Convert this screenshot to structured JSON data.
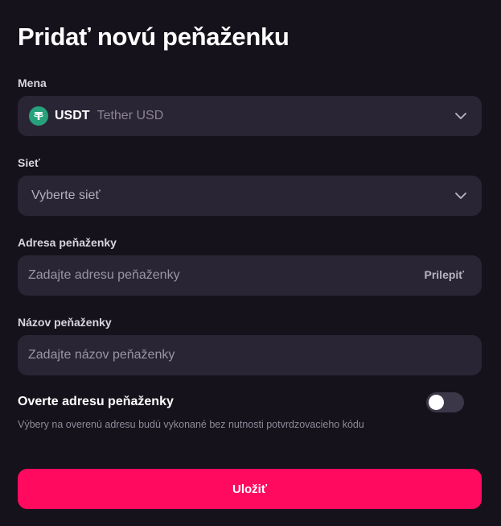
{
  "modal": {
    "title": "Pridať novú peňaženku"
  },
  "currency": {
    "label": "Mena",
    "code": "USDT",
    "name": "Tether USD",
    "icon": "tether-icon",
    "icon_color": "#26a17b"
  },
  "network": {
    "label": "Sieť",
    "placeholder": "Vyberte sieť"
  },
  "address": {
    "label": "Adresa peňaženky",
    "placeholder": "Zadajte adresu peňaženky",
    "value": "",
    "paste_label": "Prilepiť"
  },
  "wallet_name": {
    "label": "Názov peňaženky",
    "placeholder": "Zadajte názov peňaženky",
    "value": ""
  },
  "verify": {
    "title": "Overte adresu peňaženky",
    "description": "Výbery na overenú adresu budú vykonané bez nutnosti potvrdzovacieho kódu",
    "enabled": false
  },
  "actions": {
    "save_label": "Uložiť",
    "save_color": "#ff0a5f"
  }
}
